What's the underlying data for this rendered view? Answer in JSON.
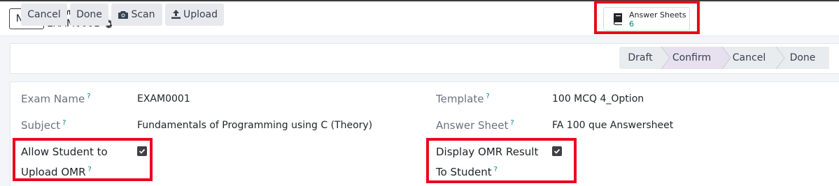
{
  "header": {
    "new_label": "New",
    "breadcrumb_parent": "Exam",
    "record_name": "EXAM0001",
    "smart_button": {
      "label": "Answer Sheets",
      "count": "6"
    }
  },
  "actions": {
    "cancel": "Cancel",
    "done": "Done",
    "scan": "Scan",
    "upload": "Upload"
  },
  "stages": [
    {
      "label": "Draft",
      "active": false
    },
    {
      "label": "Confirm",
      "active": true
    },
    {
      "label": "Cancel",
      "active": false
    },
    {
      "label": "Done",
      "active": false
    }
  ],
  "form": {
    "exam_name": {
      "label": "Exam Name",
      "help": "?",
      "value": "EXAM0001"
    },
    "subject": {
      "label": "Subject",
      "help": "?",
      "value": "Fundamentals of Programming using C (Theory)"
    },
    "allow_upload": {
      "label_line1": "Allow Student to",
      "label_line2": "Upload OMR",
      "help": "?",
      "checked": true
    },
    "template": {
      "label": "Template",
      "help": "?",
      "value": "100 MCQ 4_Option"
    },
    "answer_sheet": {
      "label": "Answer Sheet",
      "help": "?",
      "value": "FA 100 que Answersheet"
    },
    "display_result": {
      "label_line1": "Display OMR Result",
      "label_line2": "To Student",
      "help": "?",
      "checked": true
    }
  },
  "colors": {
    "accent": "#017e84",
    "highlight": "#e8091c",
    "active_stage": "#e6e0ef"
  }
}
